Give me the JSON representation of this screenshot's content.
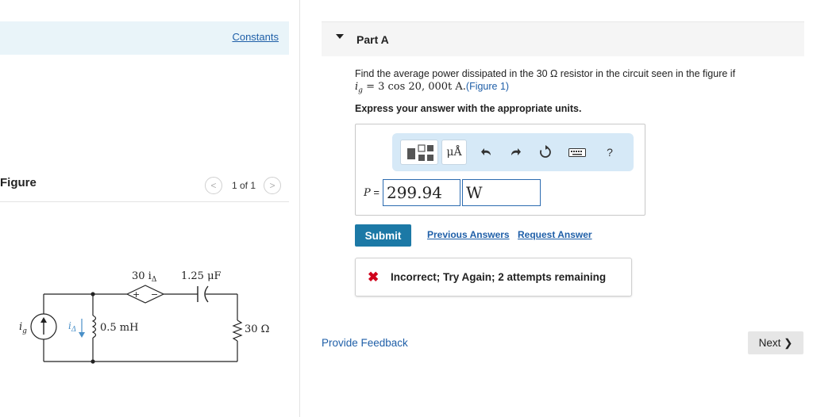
{
  "constants": {
    "label": "Constants"
  },
  "figure": {
    "label": "Figure",
    "pager": {
      "prev": "<",
      "count": "1 of 1",
      "next": ">"
    },
    "circuit": {
      "source_label": "i",
      "source_sub": "g",
      "dependent_label": "30 i",
      "dependent_sub": "Δ",
      "dependent_plus": "+",
      "dependent_minus": "−",
      "capacitor_label": "1.25 μF",
      "current_label": "i",
      "current_sub": "Δ",
      "inductor_label": "0.5 mH",
      "resistor_label": "30 Ω"
    }
  },
  "part": {
    "title": "Part A"
  },
  "question": {
    "text_1": "Find the average power dissipated in the 30 Ω resistor in the circuit seen in the figure if",
    "equation_lhs": "i",
    "equation_sub": "g",
    "equation_rhs": " = 3 cos 20, 000t A.",
    "figure_link": "(Figure 1)"
  },
  "instructions": "Express your answer with the appropriate units.",
  "toolbar": {
    "units_label": "μÅ",
    "help_label": "?"
  },
  "answer": {
    "label_var": "P",
    "label_eq": " =",
    "value": "299.94",
    "unit": "W"
  },
  "actions": {
    "submit": "Submit",
    "previous_answers": "Previous Answers",
    "request_answer": "Request Answer"
  },
  "feedback": {
    "icon": "✖",
    "message": "Incorrect; Try Again; 2 attempts remaining"
  },
  "footer": {
    "provide_feedback": "Provide Feedback",
    "next": "Next ❯"
  },
  "colors": {
    "accent": "#1c79a6",
    "link": "#1f5fa8",
    "error": "#d0021b",
    "toolbar_bg": "#d6e9f7",
    "constants_bg": "#e9f4f9"
  }
}
